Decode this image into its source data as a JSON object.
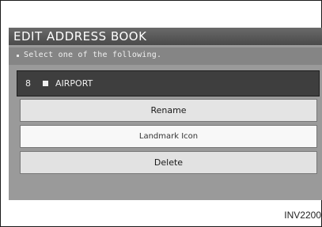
{
  "title": "EDIT ADDRESS BOOK",
  "instruction": "Select one of the following.",
  "selected_entry": {
    "number": "8",
    "icon": "square-icon",
    "name": "AIRPORT"
  },
  "buttons": {
    "rename": "Rename",
    "landmark_icon": "Landmark Icon",
    "delete": "Delete"
  },
  "reference_code": "INV2200"
}
